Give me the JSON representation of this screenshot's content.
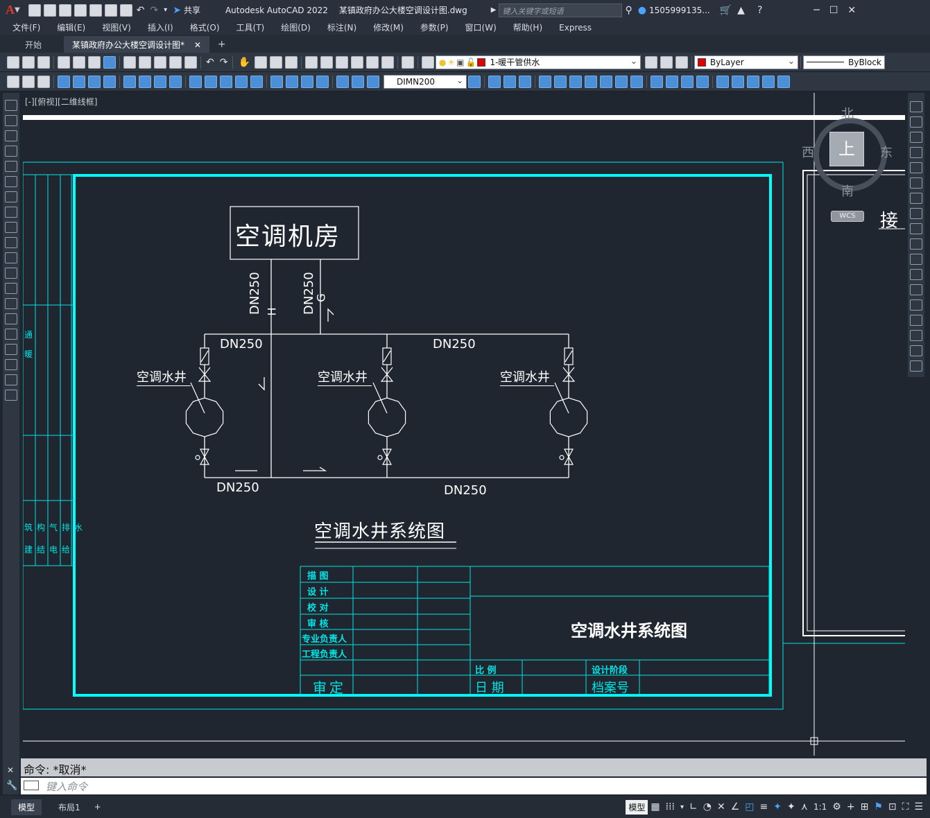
{
  "app": {
    "title": "Autodesk AutoCAD 2022",
    "file_name": "某镇政府办公大楼空调设计图.dwg",
    "search_placeholder": "键入关键字或短语",
    "user": "1505999135...",
    "share_label": "共享",
    "app_letter": "A"
  },
  "menu": [
    "文件(F)",
    "编辑(E)",
    "视图(V)",
    "插入(I)",
    "格式(O)",
    "工具(T)",
    "绘图(D)",
    "标注(N)",
    "修改(M)",
    "参数(P)",
    "窗口(W)",
    "帮助(H)",
    "Express"
  ],
  "tabs": {
    "start": "开始",
    "active": "某镇政府办公大楼空调设计图*"
  },
  "toolbar": {
    "layer_value": "1-暖干管供水",
    "color_value": "ByLayer",
    "linetype_value": "ByBlock",
    "dimstyle_value": "DIMN200"
  },
  "viewport": {
    "label": "[-][俯视][二维线框]"
  },
  "viewcube": {
    "north": "北",
    "south": "南",
    "east": "东",
    "west": "西",
    "top": "上",
    "wcs": "WCS"
  },
  "drawing": {
    "room_label": "空调机房",
    "dn250": "DN250",
    "h_mark": "H",
    "g_mark": "G",
    "well_label": "空调水井",
    "diagram_title": "空调水井系统图",
    "partial_text": "接",
    "left_strip_top": [
      "通",
      "暖"
    ],
    "left_strip_bottom": [
      [
        "筑",
        "建"
      ],
      [
        "构",
        "结"
      ],
      [
        "气",
        "电"
      ],
      [
        "排",
        "给"
      ],
      [
        "水",
        ""
      ]
    ],
    "title_block": {
      "rows": [
        "描 图",
        "设 计",
        "校 对",
        "审 核",
        "专业负责人",
        "工程负责人"
      ],
      "approve": "审定",
      "scale": "比 例",
      "date": "日 期",
      "stage": "设计阶段",
      "archive": "档案号",
      "title": "空调水井系统图"
    }
  },
  "command": {
    "history": "命令: *取消*",
    "placeholder": "键入命令"
  },
  "status": {
    "model_tab": "模型",
    "layout_tab": "布局1",
    "model_btn": "模型",
    "scale": "1:1"
  }
}
